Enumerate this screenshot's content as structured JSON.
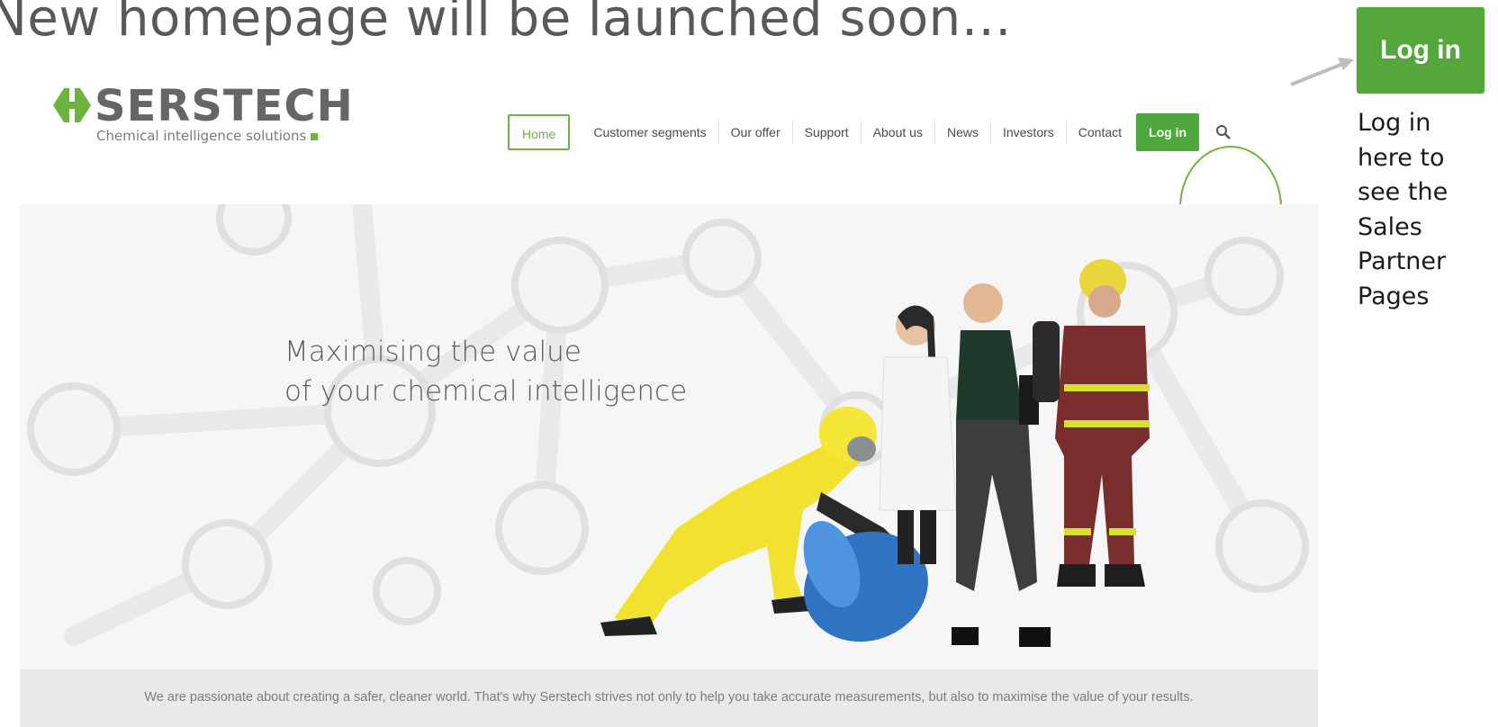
{
  "slide_title": "New homepage will be launched soon…",
  "brand": {
    "name": "SERSTECH",
    "tagline": "Chemical intelligence solutions",
    "green": "#6db33f",
    "gray": "#666666"
  },
  "nav": {
    "home": "Home",
    "items": [
      "Customer segments",
      "Our offer",
      "Support",
      "About us",
      "News",
      "Investors",
      "Contact"
    ],
    "login": "Log in",
    "search_icon": "search-icon"
  },
  "hero": {
    "line1": "Maximising the value",
    "line2": "of your chemical intelligence",
    "footer": "We are passionate about creating a safer, cleaner world. That's why Serstech strives not only to help you take accurate measurements, but also to maximise the value of your results."
  },
  "callout": {
    "button": "Log in",
    "text": "Log in here to see the Sales Partner Pages"
  }
}
